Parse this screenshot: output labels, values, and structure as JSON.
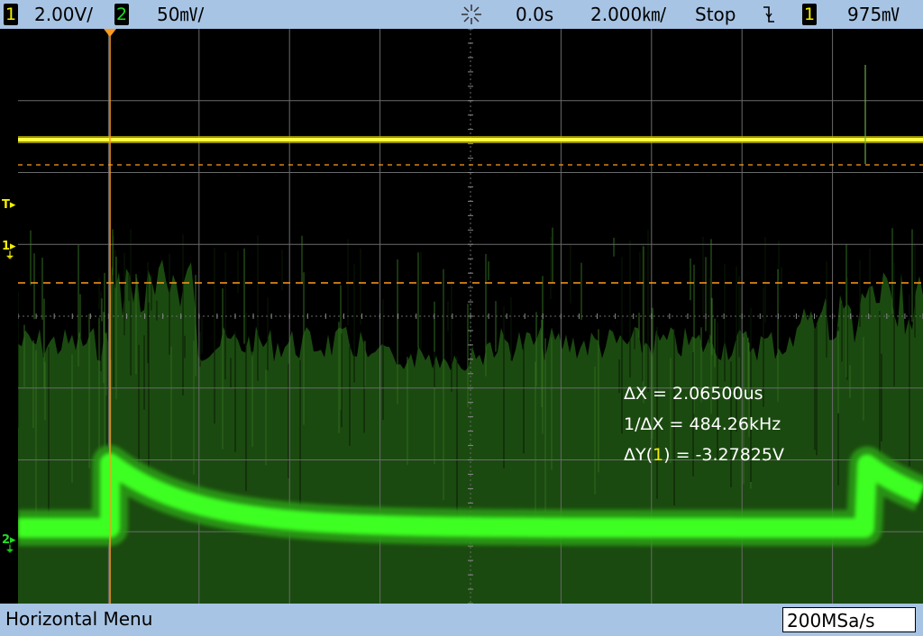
{
  "status": {
    "ch1_num": "1",
    "ch1_scale": "2.00V/",
    "ch2_num": "2",
    "ch2_scale": "50㎷/",
    "acq_icon": "sunburst-icon",
    "time_offset": "0.0s",
    "time_scale": "2.000㎞/",
    "run_state": "Stop",
    "trigger_edge_icon": "falling-edge-icon",
    "trigger_source": "1",
    "trigger_level": "975㎷"
  },
  "left_markers": {
    "trigger": "T",
    "ch1": "1",
    "ch2": "2"
  },
  "measurements": {
    "delta_x": "ΔX = 2.06500us",
    "inv_delta_x": "1/ΔX = 484.26kHz",
    "delta_y_prefix": "ΔY(",
    "delta_y_ch": "1",
    "delta_y_suffix": ") = -3.27825V"
  },
  "bottom": {
    "menu_title": "Horizontal Menu",
    "sample_rate": "200MSa/s"
  },
  "colors": {
    "ch1": "#f3f000",
    "ch2": "#22dd22",
    "cursor": "#ff9a1e",
    "grid": "#6a6a6a",
    "status_bg": "#a8c4e4"
  }
}
